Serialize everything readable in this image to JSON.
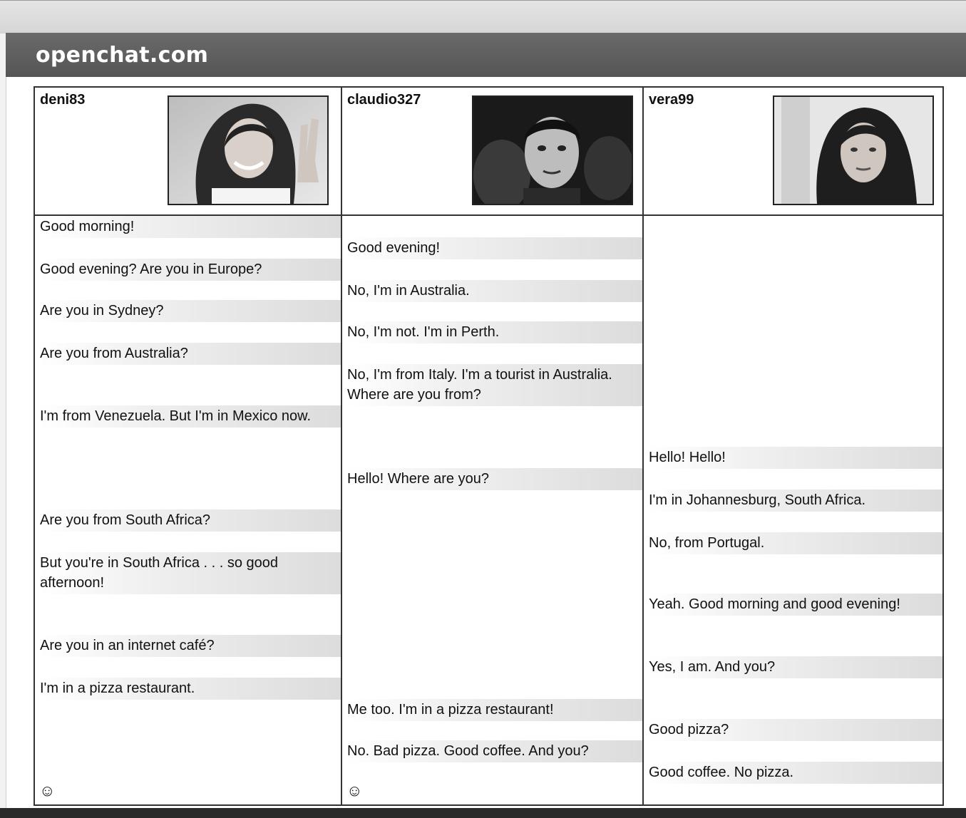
{
  "site": {
    "title": "openchat.com"
  },
  "users": [
    {
      "username": "deni83",
      "messages": [
        "Good morning!",
        "Good evening? Are you in Europe?",
        "Are you in Sydney?",
        "Are you from Australia?",
        "I'm from Venezuela. But I'm in Mexico now.",
        "Are you from South Africa?",
        "But you're in South Africa . . . so good afternoon!",
        "Are you in an internet café?",
        "I'm in a pizza restaurant."
      ],
      "emoji_icon": "smiley-icon",
      "emoji_glyph": "☺"
    },
    {
      "username": "claudio327",
      "messages": [
        "Good evening!",
        "No, I'm in Australia.",
        "No, I'm not. I'm in Perth.",
        "No, I'm from Italy. I'm a tourist in Australia. Where are you from?",
        "Hello! Where are you?",
        "Me too. I'm in a pizza restaurant!",
        "No. Bad pizza. Good coffee. And you?"
      ],
      "emoji_icon": "smiley-icon",
      "emoji_glyph": "☺"
    },
    {
      "username": "vera99",
      "messages": [
        "Hello! Hello!",
        "I'm in Johannesburg, South Africa.",
        "No, from Portugal.",
        "Yeah. Good morning and good evening!",
        "Yes, I am. And you?",
        "Good pizza?",
        "Good coffee. No pizza."
      ]
    }
  ],
  "colors": {
    "header_bg": "#5e5e5e",
    "header_text": "#ffffff",
    "border": "#333333",
    "message_highlight": "#dcdcdc"
  }
}
